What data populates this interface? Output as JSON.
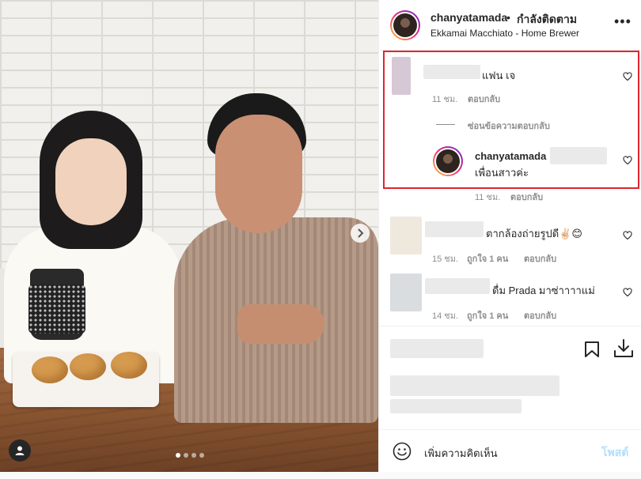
{
  "header": {
    "username": "chanyatamada",
    "separator": "•",
    "follow_status": "กำลังติดตาม",
    "location": "Ekkamai Macchiato - Home Brewer",
    "more_icon": "more-horizontal-icon"
  },
  "comments": [
    {
      "text": "แฟน เจ",
      "time": "11 ชม.",
      "reply": "ตอบกลับ",
      "hide_replies": "ซ่อนข้อความตอบกลับ",
      "replies": [
        {
          "username": "chanyatamada",
          "text": "เพื่อนสาวค่ะ",
          "time": "11 ชม.",
          "reply": "ตอบกลับ"
        }
      ]
    },
    {
      "text": "ตากล้องถ่ายรูปดี✌🏻😊",
      "time": "15 ชม.",
      "likes": "ถูกใจ 1 คน",
      "reply": "ตอบกลับ"
    },
    {
      "text": "ดื่ม Prada มาซ่าาาาแม่",
      "time": "14 ชม.",
      "likes": "ถูกใจ 1 คน",
      "reply": "ตอบกลับ"
    }
  ],
  "actions": {
    "save_icon": "bookmark-icon",
    "download_icon": "download-icon"
  },
  "input": {
    "emoji_icon": "emoji-icon",
    "placeholder": "เพิ่มความคิดเห็น",
    "post_label": "โพสต์"
  },
  "photo": {
    "next_icon": "chevron-right-icon",
    "tag_icon": "user-tag-icon",
    "carousel_index": 1,
    "carousel_count": 4
  },
  "colors": {
    "highlight_box": "#e0252e",
    "post_button_disabled": "#b2dffc",
    "meta_text": "#8e8e8e"
  }
}
